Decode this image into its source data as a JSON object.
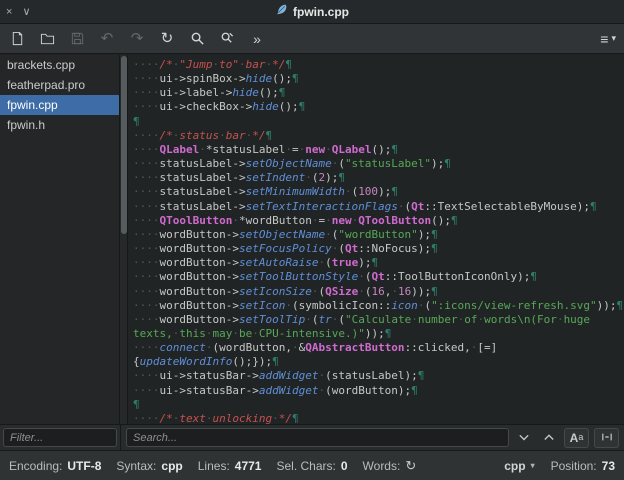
{
  "window": {
    "title": "fpwin.cpp",
    "close_icon": "×",
    "shade_icon": "∨"
  },
  "toolbar": {
    "undo_icon": "↶",
    "redo_icon": "↷",
    "reload_icon": "↻",
    "overflow_icon": "»",
    "menu_icon": "≡",
    "menu_caret": "▾"
  },
  "sidebar": {
    "files": [
      {
        "name": "brackets.cpp",
        "selected": false
      },
      {
        "name": "featherpad.pro",
        "selected": false
      },
      {
        "name": "fpwin.cpp",
        "selected": true
      },
      {
        "name": "fpwin.h",
        "selected": false
      }
    ],
    "filter_placeholder": "Filter..."
  },
  "search": {
    "placeholder": "Search...",
    "match_case_big": "A",
    "match_case_small": "a"
  },
  "statusbar": {
    "encoding_label": "Encoding:",
    "encoding_value": "UTF-8",
    "syntax_label": "Syntax:",
    "syntax_value": "cpp",
    "lines_label": "Lines:",
    "lines_value": "4771",
    "sel_label": "Sel. Chars:",
    "sel_value": "0",
    "words_label": "Words:",
    "words_refresh_icon": "↻",
    "lang_selector": "cpp",
    "lang_caret": "▾",
    "position_label": "Position:",
    "position_value": "73"
  },
  "editor": {
    "colors": {
      "background": "#212425",
      "default_text": "#c5c8c6",
      "comment": "#c4524f",
      "keyword": "#cf6bcf",
      "function": "#5f8fd7",
      "string": "#57a857",
      "number": "#c586c0",
      "whitespace_mark": "#4d5a57",
      "pilcrow": "#2e7d6b",
      "selection": "#3d6ca6"
    },
    "lines": [
      [
        [
          "txt",
          "····"
        ],
        [
          "cmt",
          "/*·\"Jump·to\"·bar·*/"
        ],
        [
          "pil",
          "¶"
        ]
      ],
      [
        [
          "txt",
          "····ui->spinBox->"
        ],
        [
          "fn",
          "hide"
        ],
        [
          "txt",
          "();"
        ],
        [
          "pil",
          "¶"
        ]
      ],
      [
        [
          "txt",
          "····ui->label->"
        ],
        [
          "fn",
          "hide"
        ],
        [
          "txt",
          "();"
        ],
        [
          "pil",
          "¶"
        ]
      ],
      [
        [
          "txt",
          "····ui->checkBox->"
        ],
        [
          "fn",
          "hide"
        ],
        [
          "txt",
          "();"
        ],
        [
          "pil",
          "¶"
        ]
      ],
      [
        [
          "pil",
          "¶"
        ]
      ],
      [
        [
          "txt",
          "····"
        ],
        [
          "cmt",
          "/*·status·bar·*/"
        ],
        [
          "pil",
          "¶"
        ]
      ],
      [
        [
          "txt",
          "····"
        ],
        [
          "kw",
          "QLabel"
        ],
        [
          "txt",
          "·*statusLabel·=·"
        ],
        [
          "kw",
          "new"
        ],
        [
          "txt",
          "·"
        ],
        [
          "kw",
          "QLabel"
        ],
        [
          "txt",
          "();"
        ],
        [
          "pil",
          "¶"
        ]
      ],
      [
        [
          "txt",
          "····statusLabel->"
        ],
        [
          "fn",
          "setObjectName"
        ],
        [
          "txt",
          "·("
        ],
        [
          "str",
          "\"statusLabel\""
        ],
        [
          "txt",
          ");"
        ],
        [
          "pil",
          "¶"
        ]
      ],
      [
        [
          "txt",
          "····statusLabel->"
        ],
        [
          "fn",
          "setIndent"
        ],
        [
          "txt",
          "·("
        ],
        [
          "num",
          "2"
        ],
        [
          "txt",
          ");"
        ],
        [
          "pil",
          "¶"
        ]
      ],
      [
        [
          "txt",
          "····statusLabel->"
        ],
        [
          "fn",
          "setMinimumWidth"
        ],
        [
          "txt",
          "·("
        ],
        [
          "num",
          "100"
        ],
        [
          "txt",
          ");"
        ],
        [
          "pil",
          "¶"
        ]
      ],
      [
        [
          "txt",
          "····statusLabel->"
        ],
        [
          "fn",
          "setTextInteractionFlags"
        ],
        [
          "txt",
          "·("
        ],
        [
          "kw",
          "Qt"
        ],
        [
          "txt",
          "::TextSelectableByMouse);"
        ],
        [
          "pil",
          "¶"
        ]
      ],
      [
        [
          "txt",
          "····"
        ],
        [
          "kw",
          "QToolButton"
        ],
        [
          "txt",
          "·*wordButton·=·"
        ],
        [
          "kw",
          "new"
        ],
        [
          "txt",
          "·"
        ],
        [
          "kw",
          "QToolButton"
        ],
        [
          "txt",
          "();"
        ],
        [
          "pil",
          "¶"
        ]
      ],
      [
        [
          "txt",
          "····wordButton->"
        ],
        [
          "fn",
          "setObjectName"
        ],
        [
          "txt",
          "·("
        ],
        [
          "str",
          "\"wordButton\""
        ],
        [
          "txt",
          ");"
        ],
        [
          "pil",
          "¶"
        ]
      ],
      [
        [
          "txt",
          "····wordButton->"
        ],
        [
          "fn",
          "setFocusPolicy"
        ],
        [
          "txt",
          "·("
        ],
        [
          "kw",
          "Qt"
        ],
        [
          "txt",
          "::NoFocus);"
        ],
        [
          "pil",
          "¶"
        ]
      ],
      [
        [
          "txt",
          "····wordButton->"
        ],
        [
          "fn",
          "setAutoRaise"
        ],
        [
          "txt",
          "·("
        ],
        [
          "kw",
          "true"
        ],
        [
          "txt",
          ");"
        ],
        [
          "pil",
          "¶"
        ]
      ],
      [
        [
          "txt",
          "····wordButton->"
        ],
        [
          "fn",
          "setToolButtonStyle"
        ],
        [
          "txt",
          "·("
        ],
        [
          "kw",
          "Qt"
        ],
        [
          "txt",
          "::ToolButtonIconOnly);"
        ],
        [
          "pil",
          "¶"
        ]
      ],
      [
        [
          "txt",
          "····wordButton->"
        ],
        [
          "fn",
          "setIconSize"
        ],
        [
          "txt",
          "·("
        ],
        [
          "kw",
          "QSize"
        ],
        [
          "txt",
          "·("
        ],
        [
          "num",
          "16"
        ],
        [
          "txt",
          ",·"
        ],
        [
          "num",
          "16"
        ],
        [
          "txt",
          "));"
        ],
        [
          "pil",
          "¶"
        ]
      ],
      [
        [
          "txt",
          "····wordButton->"
        ],
        [
          "fn",
          "setIcon"
        ],
        [
          "txt",
          "·(symbolicIcon::"
        ],
        [
          "fn",
          "icon"
        ],
        [
          "txt",
          "·("
        ],
        [
          "str",
          "\":icons/view-refresh.svg\""
        ],
        [
          "txt",
          "));"
        ],
        [
          "pil",
          "¶"
        ]
      ],
      [
        [
          "txt",
          "····wordButton->"
        ],
        [
          "fn",
          "setToolTip"
        ],
        [
          "txt",
          "·("
        ],
        [
          "fn",
          "tr"
        ],
        [
          "txt",
          "·("
        ],
        [
          "str",
          "\"Calculate·number·of·words\\n(For·huge"
        ]
      ],
      [
        [
          "str",
          "texts,·this·may·be·CPU-intensive.)\""
        ],
        [
          "txt",
          "));"
        ],
        [
          "pil",
          "¶"
        ]
      ],
      [
        [
          "txt",
          "····"
        ],
        [
          "fn",
          "connect"
        ],
        [
          "txt",
          "·(wordButton,·&"
        ],
        [
          "kw",
          "QAbstractButton"
        ],
        [
          "txt",
          "::clicked,·[=]"
        ]
      ],
      [
        [
          "txt",
          "{"
        ],
        [
          "fn",
          "updateWordInfo"
        ],
        [
          "txt",
          "();});"
        ],
        [
          "pil",
          "¶"
        ]
      ],
      [
        [
          "txt",
          "····ui->statusBar->"
        ],
        [
          "fn",
          "addWidget"
        ],
        [
          "txt",
          "·(statusLabel);"
        ],
        [
          "pil",
          "¶"
        ]
      ],
      [
        [
          "txt",
          "····ui->statusBar->"
        ],
        [
          "fn",
          "addWidget"
        ],
        [
          "txt",
          "·(wordButton);"
        ],
        [
          "pil",
          "¶"
        ]
      ],
      [
        [
          "pil",
          "¶"
        ]
      ],
      [
        [
          "txt",
          "····"
        ],
        [
          "cmt",
          "/*·text·unlocking·*/"
        ],
        [
          "pil",
          "¶"
        ]
      ]
    ]
  }
}
